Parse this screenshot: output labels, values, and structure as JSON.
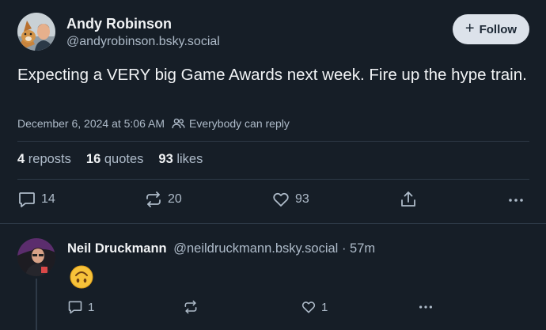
{
  "post": {
    "author": {
      "name": "Andy Robinson",
      "handle": "@andyrobinson.bsky.social"
    },
    "follow_label": "Follow",
    "text": "Expecting a VERY big Game Awards next week. Fire up the hype train.",
    "timestamp": "December 6, 2024 at 5:06 AM",
    "reply_setting": "Everybody can reply",
    "stats": {
      "reposts_count": "4",
      "reposts_label": "reposts",
      "quotes_count": "16",
      "quotes_label": "quotes",
      "likes_count": "93",
      "likes_label": "likes"
    },
    "actions": {
      "reply_count": "14",
      "repost_count": "20",
      "like_count": "93"
    }
  },
  "reply": {
    "author": {
      "name": "Neil Druckmann",
      "handle": "@neildruckmann.bsky.social"
    },
    "separator": "·",
    "time": "57m",
    "content_icon": "upside-down-face-emoji",
    "actions": {
      "reply_count": "1",
      "like_count": "1"
    }
  },
  "icons": {
    "reply": "speech-bubble-icon",
    "repost": "repost-arrows-icon",
    "like": "heart-icon",
    "share": "share-icon",
    "more": "more-dots-icon",
    "audience": "people-icon",
    "follow": "plus-icon"
  },
  "colors": {
    "background": "#161e27",
    "text": "#f1f3f5",
    "muted": "#aebbc9",
    "divider": "#2e3a47",
    "follow_button_bg": "#dce2ea"
  }
}
